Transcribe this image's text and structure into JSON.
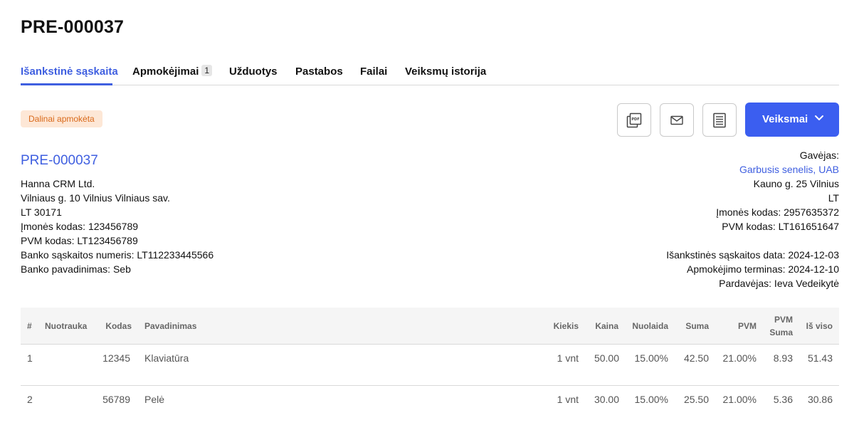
{
  "page": {
    "title": "PRE-000037"
  },
  "tabs": [
    {
      "label": "Išankstinė sąskaita",
      "active": true
    },
    {
      "label": "Apmokėjimai",
      "count": "1"
    },
    {
      "label": "Užduotys"
    },
    {
      "label": "Pastabos"
    },
    {
      "label": "Failai"
    },
    {
      "label": "Veiksmų istorija"
    }
  ],
  "status": {
    "label": "Dalinai apmokėta",
    "bg_color": "#fde7d6",
    "text_color": "#d9691a"
  },
  "toolbar": {
    "icons": [
      "pdf-icon",
      "mail-icon",
      "document-icon"
    ],
    "actions_label": "Veiksmai",
    "accent_color": "#3b5ef0"
  },
  "invoice": {
    "number": "PRE-000037",
    "seller": {
      "name": "Hanna CRM Ltd.",
      "address": "Vilniaus g. 10 Vilnius Vilniaus sav.",
      "postcode": "LT 30171",
      "company_code": "Įmonės kodas: 123456789",
      "vat_code": "PVM kodas: LT123456789",
      "bank_account": "Banko sąskaitos numeris: LT112233445566",
      "bank_name": "Banko pavadinimas: Seb"
    },
    "buyer": {
      "heading": "Gavėjas:",
      "name": "Garbusis senelis, UAB",
      "address": "Kauno g. 25 Vilnius",
      "country": "LT",
      "company_code": "Įmonės kodas: 2957635372",
      "vat_code": "PVM kodas: LT161651647"
    },
    "meta": {
      "date": "Išankstinės sąskaitos data: 2024-12-03",
      "due": "Apmokėjimo terminas: 2024-12-10",
      "seller_person": "Pardavėjas: Ieva Vedeikytė"
    }
  },
  "table": {
    "headers": {
      "num": "#",
      "photo": "Nuotrauka",
      "code": "Kodas",
      "name": "Pavadinimas",
      "qty": "Kiekis",
      "price": "Kaina",
      "discount": "Nuolaida",
      "sum": "Suma",
      "vat": "PVM",
      "vat_sum_1": "PVM",
      "vat_sum_2": "Suma",
      "total": "Iš viso"
    },
    "rows": [
      {
        "num": "1",
        "code": "12345",
        "name": "Klaviatūra",
        "qty": "1 vnt",
        "price": "50.00",
        "discount": "15.00%",
        "sum": "42.50",
        "vat": "21.00%",
        "vat_sum": "8.93",
        "total": "51.43"
      },
      {
        "num": "2",
        "code": "56789",
        "name": "Pelė",
        "qty": "1 vnt",
        "price": "30.00",
        "discount": "15.00%",
        "sum": "25.50",
        "vat": "21.00%",
        "vat_sum": "5.36",
        "total": "30.86"
      }
    ]
  }
}
